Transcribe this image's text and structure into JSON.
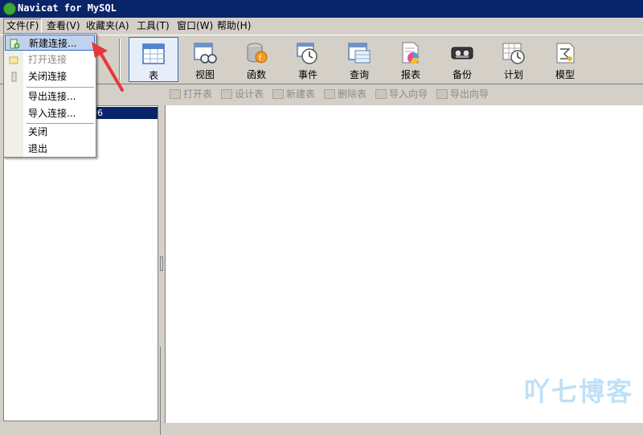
{
  "window": {
    "title": "Navicat for MySQL"
  },
  "menubar": {
    "items": [
      {
        "label": "文件(F)"
      },
      {
        "label": "查看(V)"
      },
      {
        "label": "收藏夹(A)"
      },
      {
        "label": "工具(T)"
      },
      {
        "label": "窗口(W)"
      },
      {
        "label": "帮助(H)"
      }
    ]
  },
  "toolbar": {
    "buttons": [
      {
        "label": "表",
        "icon": "table-icon",
        "selected": true
      },
      {
        "label": "视图",
        "icon": "view-icon"
      },
      {
        "label": "函数",
        "icon": "function-icon"
      },
      {
        "label": "事件",
        "icon": "event-icon"
      },
      {
        "label": "查询",
        "icon": "query-icon"
      },
      {
        "label": "报表",
        "icon": "report-icon"
      },
      {
        "label": "备份",
        "icon": "backup-icon"
      },
      {
        "label": "计划",
        "icon": "schedule-icon"
      },
      {
        "label": "模型",
        "icon": "model-icon"
      }
    ]
  },
  "objbar": {
    "buttons": [
      {
        "label": "打开表"
      },
      {
        "label": "设计表"
      },
      {
        "label": "新建表"
      },
      {
        "label": "删除表"
      },
      {
        "label": "导入向导"
      },
      {
        "label": "导出向导"
      }
    ]
  },
  "connection_tree": {
    "selected_label": "06"
  },
  "file_menu": {
    "items": [
      {
        "label": "新建连接...",
        "highlighted": true
      },
      {
        "label": "打开连接",
        "disabled": true
      },
      {
        "label": "关闭连接"
      },
      {
        "label": "导出连接..."
      },
      {
        "label": "导入连接..."
      },
      {
        "label": "关闭"
      },
      {
        "label": "退出"
      }
    ]
  },
  "watermark": {
    "text": "吖七博客"
  },
  "colors": {
    "titlebar": "#0a246a",
    "selection": "#0a246a",
    "menu_highlight": "#c1d2ee",
    "annotation_arrow": "#e8383a"
  }
}
